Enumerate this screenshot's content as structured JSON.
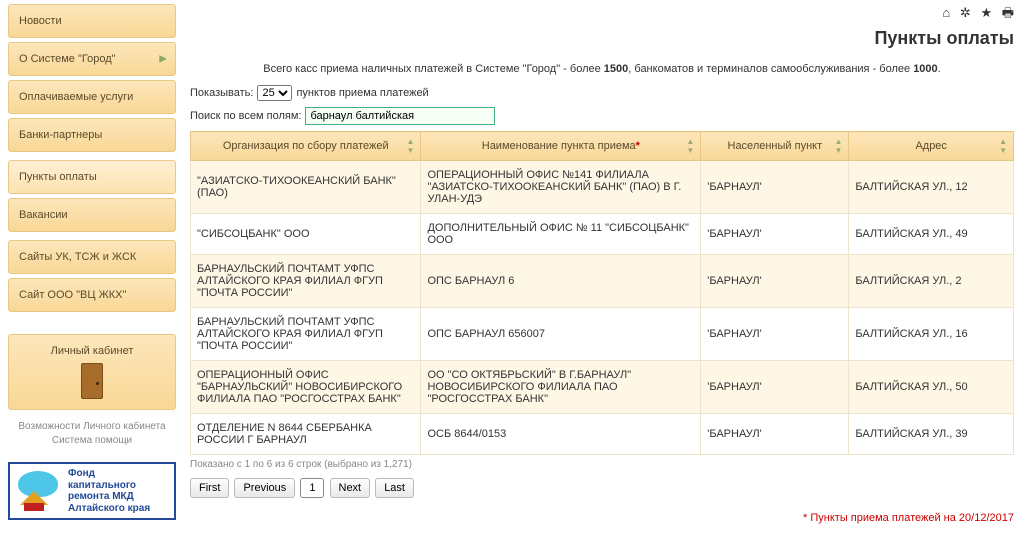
{
  "sidebar": {
    "items": [
      {
        "label": "Новости",
        "has_chev": false,
        "active": false
      },
      {
        "label": "О Системе \"Город\"",
        "has_chev": true,
        "active": false
      },
      {
        "label": "Оплачиваемые услуги",
        "has_chev": false,
        "active": false
      },
      {
        "label": "Банки-партнеры",
        "has_chev": false,
        "active": false
      },
      {
        "label": "Пункты оплаты",
        "has_chev": false,
        "active": true
      },
      {
        "label": "Вакансии",
        "has_chev": false,
        "active": false
      },
      {
        "label": "Сайты УК, ТСЖ и ЖСК",
        "has_chev": false,
        "active": false
      },
      {
        "label": "Сайт ООО \"ВЦ ЖКХ\"",
        "has_chev": false,
        "active": false
      }
    ],
    "cabinet_label": "Личный кабинет",
    "caption_line1": "Возможности Личного кабинета",
    "caption_line2": "Система помощи",
    "logo_l1": "Фонд",
    "logo_l2": "капитального",
    "logo_l3": "ремонта МКД",
    "logo_l4": "Алтайского края"
  },
  "page": {
    "title": "Пункты оплаты",
    "intro_prefix": "Всего касс приема наличных платежей в Системе \"Город\" - более ",
    "intro_bold1": "1500",
    "intro_mid": ", банкоматов и терминалов самообслуживания - более ",
    "intro_bold2": "1000",
    "intro_suffix": ".",
    "show_label": "Показывать:",
    "show_value": "25",
    "show_suffix": "пунктов приема платежей",
    "search_label": "Поиск по всем полям:",
    "search_value": "барнаул балтийская"
  },
  "table": {
    "headers": {
      "org": "Организация по сбору платежей",
      "name": "Наименование пункта приема",
      "city": "Населенный пункт",
      "addr": "Адрес"
    },
    "rows": [
      {
        "org": "\"АЗИАТСКО-ТИХООКЕАНСКИЙ БАНК\" (ПАО)",
        "name": "ОПЕРАЦИОННЫЙ ОФИС №141 ФИЛИАЛА \"АЗИАТСКО-ТИХООКЕАНСКИЙ БАНК\" (ПАО) В Г. УЛАН-УДЭ",
        "city": "'БАРНАУЛ'",
        "addr": "БАЛТИЙСКАЯ УЛ., 12"
      },
      {
        "org": "\"СИБСОЦБАНК\" ООО",
        "name": "ДОПОЛНИТЕЛЬНЫЙ ОФИС № 11 \"СИБСОЦБАНК\" ООО",
        "city": "'БАРНАУЛ'",
        "addr": "БАЛТИЙСКАЯ УЛ., 49"
      },
      {
        "org": "БАРНАУЛЬСКИЙ ПОЧТАМТ УФПС АЛТАЙСКОГО КРАЯ ФИЛИАЛ ФГУП \"ПОЧТА РОССИИ\"",
        "name": "ОПС БАРНАУЛ 6",
        "city": "'БАРНАУЛ'",
        "addr": "БАЛТИЙСКАЯ УЛ., 2"
      },
      {
        "org": "БАРНАУЛЬСКИЙ ПОЧТАМТ УФПС АЛТАЙСКОГО КРАЯ ФИЛИАЛ ФГУП \"ПОЧТА РОССИИ\"",
        "name": "ОПС БАРНАУЛ 656007",
        "city": "'БАРНАУЛ'",
        "addr": "БАЛТИЙСКАЯ УЛ., 16"
      },
      {
        "org": "ОПЕРАЦИОННЫЙ ОФИС \"БАРНАУЛЬСКИЙ\" НОВОСИБИРСКОГО ФИЛИАЛА ПАО \"РОСГОССТРАХ БАНК\"",
        "name": "ОО \"СО ОКТЯБРЬСКИЙ\" В Г.БАРНАУЛ\" НОВОСИБИРСКОГО ФИЛИАЛА ПАО \"РОСГОССТРАХ БАНК\"",
        "city": "'БАРНАУЛ'",
        "addr": "БАЛТИЙСКАЯ УЛ., 50"
      },
      {
        "org": "ОТДЕЛЕНИЕ N 8644 СБЕРБАНКА РОССИИ Г БАРНАУЛ",
        "name": "ОСБ 8644/0153",
        "city": "'БАРНАУЛ'",
        "addr": "БАЛТИЙСКАЯ УЛ., 39"
      }
    ],
    "summary": "Показано с 1 по 6 из 6 строк (выбрано из 1,271)"
  },
  "pager": {
    "first": "First",
    "prev": "Previous",
    "page": "1",
    "next": "Next",
    "last": "Last"
  },
  "footnote_pre": "* ",
  "footnote": "Пункты приема платежей на 20/12/2017"
}
